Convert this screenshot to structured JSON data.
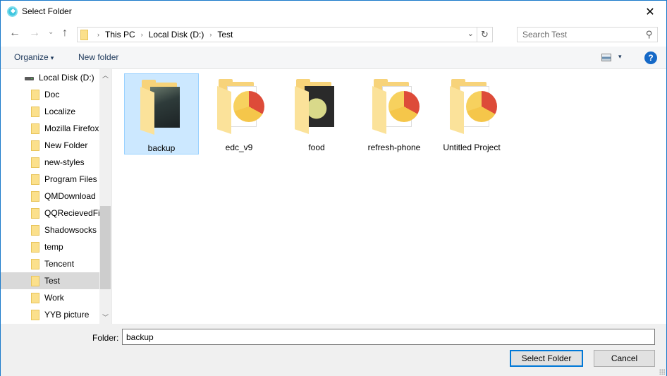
{
  "window": {
    "title": "Select Folder",
    "close_label": "✕"
  },
  "navigation": {
    "back_icon": "←",
    "forward_icon": "→",
    "recent_icon": "⌄",
    "up_icon": "↑",
    "breadcrumb": [
      "This PC",
      "Local Disk (D:)",
      "Test"
    ],
    "separator": "›",
    "dropdown_icon": "⌄",
    "refresh_icon": "↻",
    "search_placeholder": "Search Test",
    "search_icon": "⚲"
  },
  "toolbar": {
    "organize_label": "Organize",
    "organize_caret": "▾",
    "new_folder_label": "New folder",
    "view_caret": "▾",
    "help_label": "?"
  },
  "tree": {
    "drive_label": "Local Disk (D:)",
    "items": [
      {
        "label": "Doc",
        "selected": false
      },
      {
        "label": "Localize",
        "selected": false
      },
      {
        "label": "Mozilla Firefox",
        "selected": false
      },
      {
        "label": "New Folder",
        "selected": false
      },
      {
        "label": "new-styles",
        "selected": false
      },
      {
        "label": "Program Files (",
        "selected": false
      },
      {
        "label": "QMDownload",
        "selected": false
      },
      {
        "label": "QQRecievedFil",
        "selected": false
      },
      {
        "label": "Shadowsocks",
        "selected": false
      },
      {
        "label": "temp",
        "selected": false
      },
      {
        "label": "Tencent",
        "selected": false
      },
      {
        "label": "Test",
        "selected": true
      },
      {
        "label": "Work",
        "selected": false
      },
      {
        "label": "YYB picture",
        "selected": false
      }
    ],
    "scroll_up_icon": "︿",
    "scroll_down_icon": "﹀"
  },
  "folders": [
    {
      "name": "backup",
      "thumbnail": "dark-image",
      "selected": true
    },
    {
      "name": "edc_v9",
      "thumbnail": "document-disc",
      "selected": false
    },
    {
      "name": "food",
      "thumbnail": "food-photo",
      "selected": false
    },
    {
      "name": "refresh-phone",
      "thumbnail": "document-disc",
      "selected": false
    },
    {
      "name": "Untitled Project",
      "thumbnail": "document-disc",
      "selected": false
    }
  ],
  "footer": {
    "folder_label": "Folder:",
    "folder_value": "backup",
    "select_button": "Select Folder",
    "cancel_button": "Cancel"
  }
}
